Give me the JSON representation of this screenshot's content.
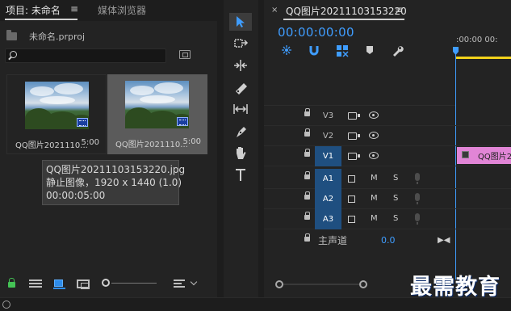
{
  "project_panel": {
    "tab_project": "项目: 未命名",
    "tab_menu": "≡",
    "tab_media_browser": "媒体浏览器",
    "project_file": "未命名.prproj",
    "items": [
      {
        "name": "QQ图片2021110...",
        "duration": "5:00",
        "selected": false
      },
      {
        "name": "QQ图片2021110...",
        "duration": "5:00",
        "selected": true
      }
    ],
    "tooltip": {
      "line1": "QQ图片20211103153220.jpg",
      "line2": "静止图像，1920 x 1440 (1.0)",
      "line3": "00:00:05:00"
    }
  },
  "timeline": {
    "close": "×",
    "title": "QQ图片20211103153220",
    "menu": "≡",
    "timecode": "00:00:00:00",
    "ruler_text": ":00:00    00:",
    "video_tracks": [
      {
        "label": "V3",
        "active": false
      },
      {
        "label": "V2",
        "active": false
      },
      {
        "label": "V1",
        "active": true
      }
    ],
    "audio_tracks": [
      {
        "label": "A1",
        "m": "M",
        "s": "S"
      },
      {
        "label": "A2",
        "m": "M",
        "s": "S"
      },
      {
        "label": "A3",
        "m": "M",
        "s": "S"
      }
    ],
    "clip_name": "QQ图片2",
    "master_label": "主声道",
    "master_value": "0.0",
    "master_end": "▶◀"
  },
  "watermark": "最需教育",
  "colors": {
    "accent_blue": "#3f9dff",
    "track_active": "#1f4f80",
    "clip_pink": "#e185d6",
    "playhead_yellow": "#f3d21b",
    "lock_green": "#44c255"
  }
}
